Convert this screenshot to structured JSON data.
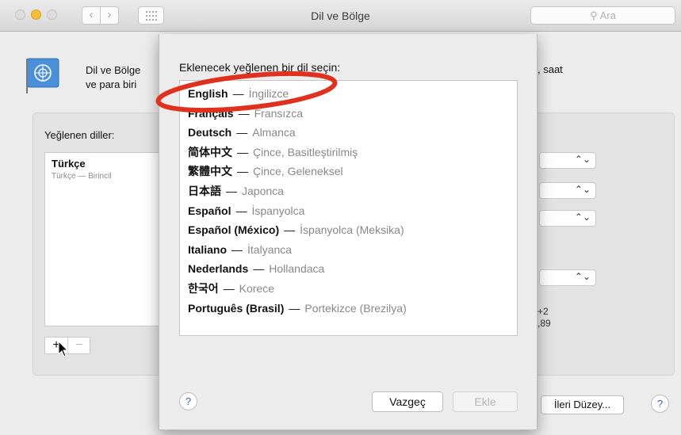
{
  "window": {
    "title": "Dil ve Bölge",
    "search_placeholder": "Ara",
    "back_glyph": "‹",
    "forward_glyph": "›"
  },
  "header": {
    "line1": "Dil ve Bölge",
    "line2": "ve para biri",
    "trailing": ", saat"
  },
  "preferred": {
    "label": "Yeğlenen diller:",
    "items": [
      {
        "name": "Türkçe",
        "subtitle": "Türkçe — Birincil"
      }
    ],
    "add": "+",
    "remove": "−"
  },
  "side": {
    "popup_arrow": "⌃⌄",
    "text1": "+2",
    "text2": ",89"
  },
  "advanced_button": "İleri Düzey...",
  "help_label": "?",
  "sheet": {
    "title": "Eklenecek yeğlenen bir dil seçin:",
    "dash": "—",
    "languages": [
      {
        "native": "English",
        "translation": "İngilizce"
      },
      {
        "native": "Français",
        "translation": "Fransızca"
      },
      {
        "native": "Deutsch",
        "translation": "Almanca"
      },
      {
        "native": "简体中文",
        "translation": "Çince, Basitleştirilmiş"
      },
      {
        "native": "繁體中文",
        "translation": "Çince, Geleneksel"
      },
      {
        "native": "日本語",
        "translation": "Japonca"
      },
      {
        "native": "Español",
        "translation": "İspanyolca"
      },
      {
        "native": "Español (México)",
        "translation": "İspanyolca (Meksika)"
      },
      {
        "native": "Italiano",
        "translation": "İtalyanca"
      },
      {
        "native": "Nederlands",
        "translation": "Hollandaca"
      },
      {
        "native": "한국어",
        "translation": "Korece"
      },
      {
        "native": "Português (Brasil)",
        "translation": "Portekizce (Brezilya)"
      }
    ],
    "cancel": "Vazgeç",
    "add": "Ekle",
    "help": "?"
  },
  "annotation": {
    "color": "#e0301e"
  },
  "colors": {
    "accent": "#2a62d9",
    "minimize": "#f6bd3b"
  }
}
